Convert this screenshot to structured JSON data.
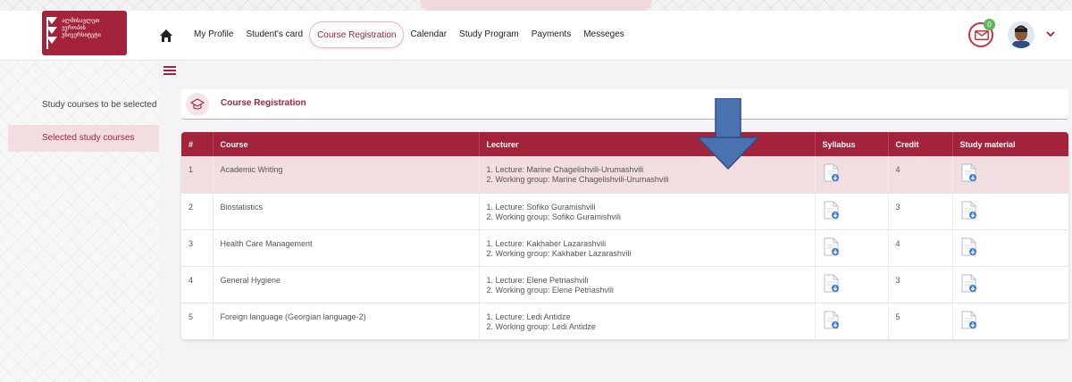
{
  "brand": {
    "logo_lines": [
      "ალმისავლეთ",
      "ევროპის",
      "უნივერსიტეტი"
    ],
    "accent_color": "#a3243a"
  },
  "nav": {
    "items": [
      "My Profile",
      "Student's card",
      "Course Registration",
      "Calendar",
      "Study Program",
      "Payments",
      "Messeges"
    ],
    "active": "Course Registration"
  },
  "header": {
    "mail_count": "0"
  },
  "sidebar": {
    "items": [
      {
        "label": "Study courses to be selected"
      },
      {
        "label": "Selected study courses"
      }
    ]
  },
  "breadcrumb": {
    "title": "Course Registration"
  },
  "table": {
    "headers": [
      "#",
      "Course",
      "Lecturer",
      "Syllabus",
      "Credit",
      "Study material"
    ],
    "rows": [
      {
        "num": "1",
        "course": "Academic Writing",
        "lecture": "1. Lecture: Marine Chagelishvili-Urumashvili",
        "group": "2. Working group: Marine Chagelishvili-Urumashvili",
        "credit": "4"
      },
      {
        "num": "2",
        "course": "Biostatistics",
        "lecture": "1. Lecture: Sofiko Guramishvili",
        "group": "2. Working group: Sofiko Guramishvili",
        "credit": "3"
      },
      {
        "num": "3",
        "course": "Health Care Management",
        "lecture": "1. Lecture: Kakhaber Lazarashvili",
        "group": "2. Working group: Kakhaber Lazarashvili",
        "credit": "4"
      },
      {
        "num": "4",
        "course": "General Hygiene",
        "lecture": "1. Lecture: Elene Petriashvili",
        "group": "2. Working group: Elene Petriashvili",
        "credit": "3"
      },
      {
        "num": "5",
        "course": "Foreign language (Georgian language-2)",
        "lecture": "1. Lecture: Ledi Antidze",
        "group": "2. Working group: Ledi Antidze",
        "credit": "5"
      }
    ]
  }
}
